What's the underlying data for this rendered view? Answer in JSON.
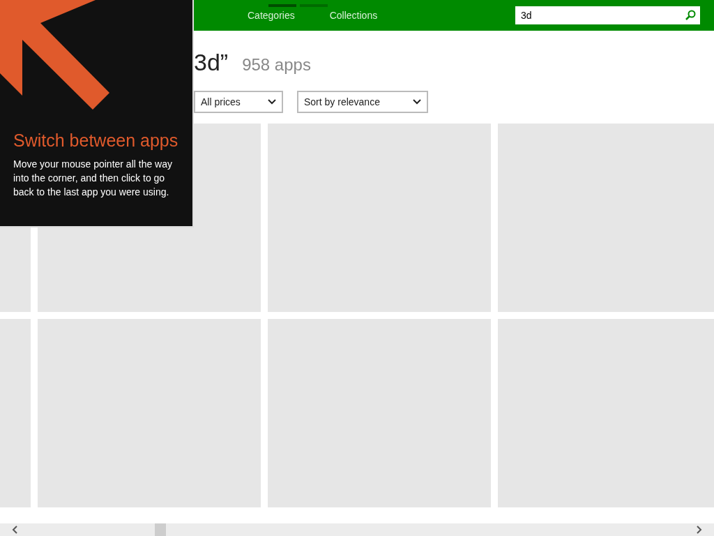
{
  "header": {
    "nav": [
      {
        "label": "Categories"
      },
      {
        "label": "Collections"
      }
    ],
    "page_indicator": [
      {
        "selected": true
      },
      {
        "selected": false
      }
    ],
    "search": {
      "value": "3d"
    }
  },
  "results": {
    "query": "3d”",
    "count": "958 apps"
  },
  "filters": [
    {
      "value": "All prices"
    },
    {
      "value": "Sort by relevance"
    }
  ],
  "tip": {
    "title": "Switch between apps",
    "body": "Move your mouse pointer all the way into the corner, and then click to go back to the last app you were using."
  }
}
